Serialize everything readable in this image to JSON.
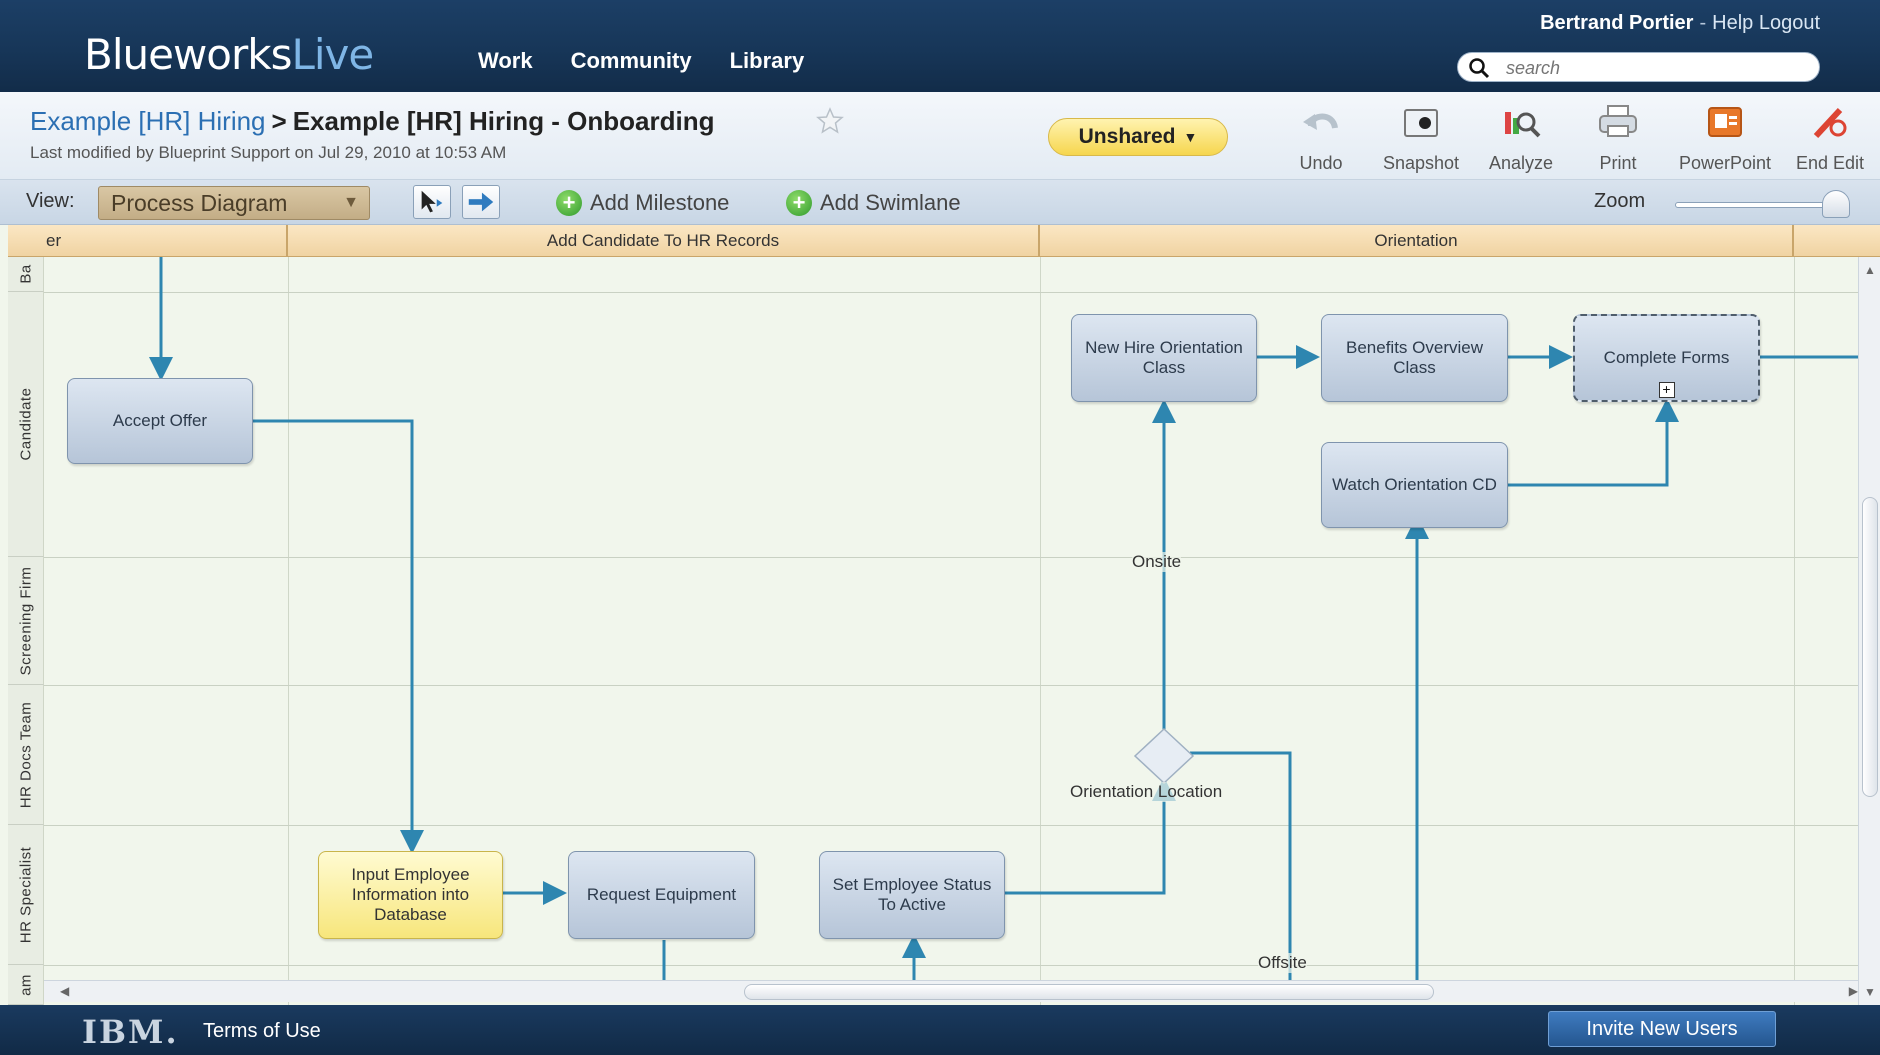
{
  "app": {
    "brand_main": "Blueworks",
    "brand_accent": "Live",
    "nav": [
      "Work",
      "Community",
      "Library"
    ],
    "user": "Bertrand Portier",
    "help": "Help",
    "logout": "Logout",
    "search_placeholder": "search"
  },
  "header": {
    "breadcrumb_parent": "Example [HR] Hiring",
    "breadcrumb_sep": ">",
    "title": "Example [HR] Hiring - Onboarding",
    "modified": "Last modified by Blueprint Support on Jul 29, 2010 at 10:53 AM",
    "share_status": "Unshared",
    "tools": {
      "undo": "Undo",
      "snapshot": "Snapshot",
      "analyze": "Analyze",
      "print": "Print",
      "powerpoint": "PowerPoint",
      "end_edit": "End Edit"
    }
  },
  "viewbar": {
    "view_label": "View:",
    "view_value": "Process Diagram",
    "add_milestone": "Add Milestone",
    "add_swimlane": "Add Swimlane",
    "zoom_label": "Zoom"
  },
  "diagram": {
    "phases": [
      "er",
      "Add Candidate To HR Records",
      "Orientation"
    ],
    "lanes": [
      "Ba",
      "Candidate",
      "Screening Firm",
      "HR Docs Team",
      "HR Specialist",
      "am"
    ],
    "tasks": {
      "accept_offer": "Accept Offer",
      "new_hire_class": "New Hire Orientation Class",
      "benefits_class": "Benefits Overview Class",
      "complete_forms": "Complete Forms",
      "watch_cd": "Watch Orientation CD",
      "input_employee": "Input Employee Information into Database",
      "request_equipment": "Request Equipment",
      "set_status": "Set Employee Status To Active"
    },
    "gateway": "Orientation Location",
    "labels": {
      "onsite": "Onsite",
      "offsite": "Offsite"
    }
  },
  "footer": {
    "logo": "IBM.",
    "terms": "Terms of Use",
    "invite": "Invite New Users"
  },
  "colors": {
    "topbar": "#173658",
    "flow_line": "#2e86b0",
    "task_fill": "#c6d3e3",
    "highlight_task": "#f7e67c",
    "unshared_button": "#f6d64e",
    "phase_header": "#f0d3a2"
  }
}
